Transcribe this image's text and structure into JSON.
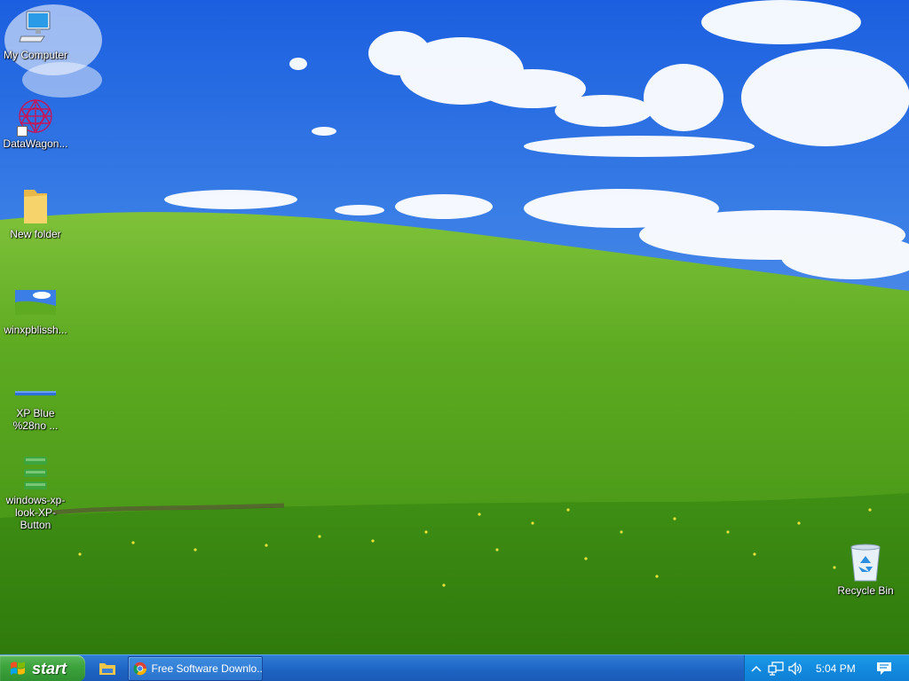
{
  "desktop": {
    "icons": [
      {
        "label": "My Computer",
        "icon": "computer-icon"
      },
      {
        "label": "DataWagon...",
        "icon": "datawagon-icon"
      },
      {
        "label": "New folder",
        "icon": "folder-icon"
      },
      {
        "label": "winxpblissh...",
        "icon": "image-thumbnail-icon"
      },
      {
        "label": "XP Blue %28no ...",
        "icon": "image-thumbnail-icon"
      },
      {
        "label": "windows-xp-look-XP-Button",
        "icon": "image-thumbnail-icon"
      },
      {
        "label": "Recycle Bin",
        "icon": "recycle-bin-icon"
      }
    ]
  },
  "taskbar": {
    "start_label": "start",
    "tasks": [
      {
        "label": "Free Software Downlo...",
        "icon": "chrome-icon"
      }
    ],
    "quick_launch": [
      {
        "icon": "file-explorer-icon"
      }
    ],
    "tray": {
      "clock": "5:04 PM",
      "icons": [
        "show-hidden-icons-chevron",
        "network-icon",
        "volume-icon",
        "action-center-icon"
      ]
    }
  },
  "colors": {
    "taskbar": "#1e63c2",
    "start_button": "#3ea53e",
    "tray": "#128ade",
    "sky": "#2f6fe0",
    "grass": "#4f9a1e"
  }
}
